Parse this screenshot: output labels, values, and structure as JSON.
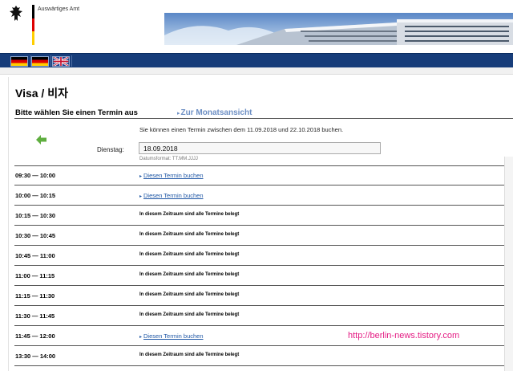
{
  "header": {
    "brand": "Auswärtiges Amt"
  },
  "nav": {
    "flags": [
      "German flag",
      "German flag",
      "UK flag"
    ]
  },
  "content": {
    "title": "Visa / 비자",
    "subtitle": "Bitte wählen Sie einen Termin aus",
    "month_link": "Zur Monatsansicht",
    "info": "Sie können einen Termin zwischen dem 11.09.2018 und 22.10.2018 buchen.",
    "date_label": "Dienstag:",
    "date_value": "18.09.2018",
    "date_hint": "Datumsformat: TT.MM.JJJJ"
  },
  "slots": [
    {
      "time": "09:30 — 10:00",
      "status": "Diesen Termin buchen",
      "bookable": true
    },
    {
      "time": "10:00 — 10:15",
      "status": "Diesen Termin buchen",
      "bookable": true
    },
    {
      "time": "10:15 — 10:30",
      "status": "In diesem Zeitraum sind alle Termine belegt",
      "bookable": false
    },
    {
      "time": "10:30 — 10:45",
      "status": "In diesem Zeitraum sind alle Termine belegt",
      "bookable": false
    },
    {
      "time": "10:45 — 11:00",
      "status": "In diesem Zeitraum sind alle Termine belegt",
      "bookable": false
    },
    {
      "time": "11:00 — 11:15",
      "status": "In diesem Zeitraum sind alle Termine belegt",
      "bookable": false
    },
    {
      "time": "11:15 — 11:30",
      "status": "In diesem Zeitraum sind alle Termine belegt",
      "bookable": false
    },
    {
      "time": "11:30 — 11:45",
      "status": "In diesem Zeitraum sind alle Termine belegt",
      "bookable": false
    },
    {
      "time": "11:45 — 12:00",
      "status": "Diesen Termin buchen",
      "bookable": true
    },
    {
      "time": "13:30 — 14:00",
      "status": "In diesem Zeitraum sind alle Termine belegt",
      "bookable": false
    }
  ],
  "watermark": "http://berlin-news.tistory.com",
  "colors": {
    "nav": "#173d7a",
    "link": "#1f57a5",
    "month_link": "#6d8fc4",
    "watermark": "#e41c83"
  }
}
